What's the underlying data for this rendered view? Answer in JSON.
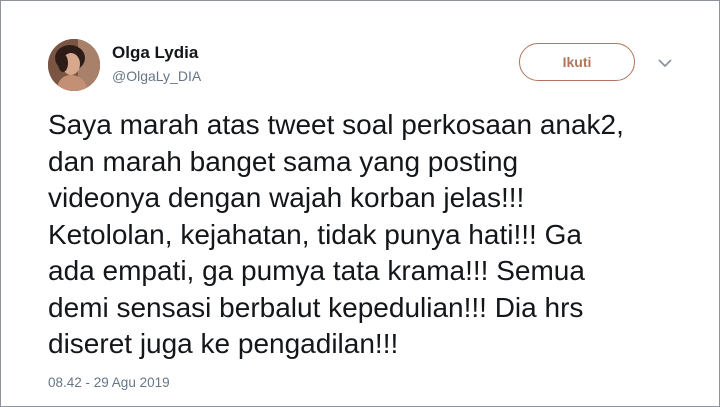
{
  "user": {
    "display_name": "Olga Lydia",
    "screen_name": "@OlgaLy_DIA",
    "avatar_icon": "profile-photo"
  },
  "actions": {
    "follow_label": "Ikuti",
    "more_icon": "chevron-down-icon"
  },
  "tweet": {
    "text": "Saya marah atas tweet soal perkosaan anak2,\ndan marah banget sama yang posting\nvideonya dengan wajah korban jelas!!!\nKetololan, kejahatan, tidak punya hati!!! Ga\nada empati, ga pumya tata krama!!! Semua\ndemi sensasi berbalut kepedulian!!! Dia hrs\ndiseret juga ke pengadilan!!!",
    "timestamp": "08.42 - 29 Agu 2019"
  },
  "colors": {
    "accent": "#b0765d",
    "text": "#14171a",
    "muted": "#657786",
    "border": "#8e9499"
  }
}
